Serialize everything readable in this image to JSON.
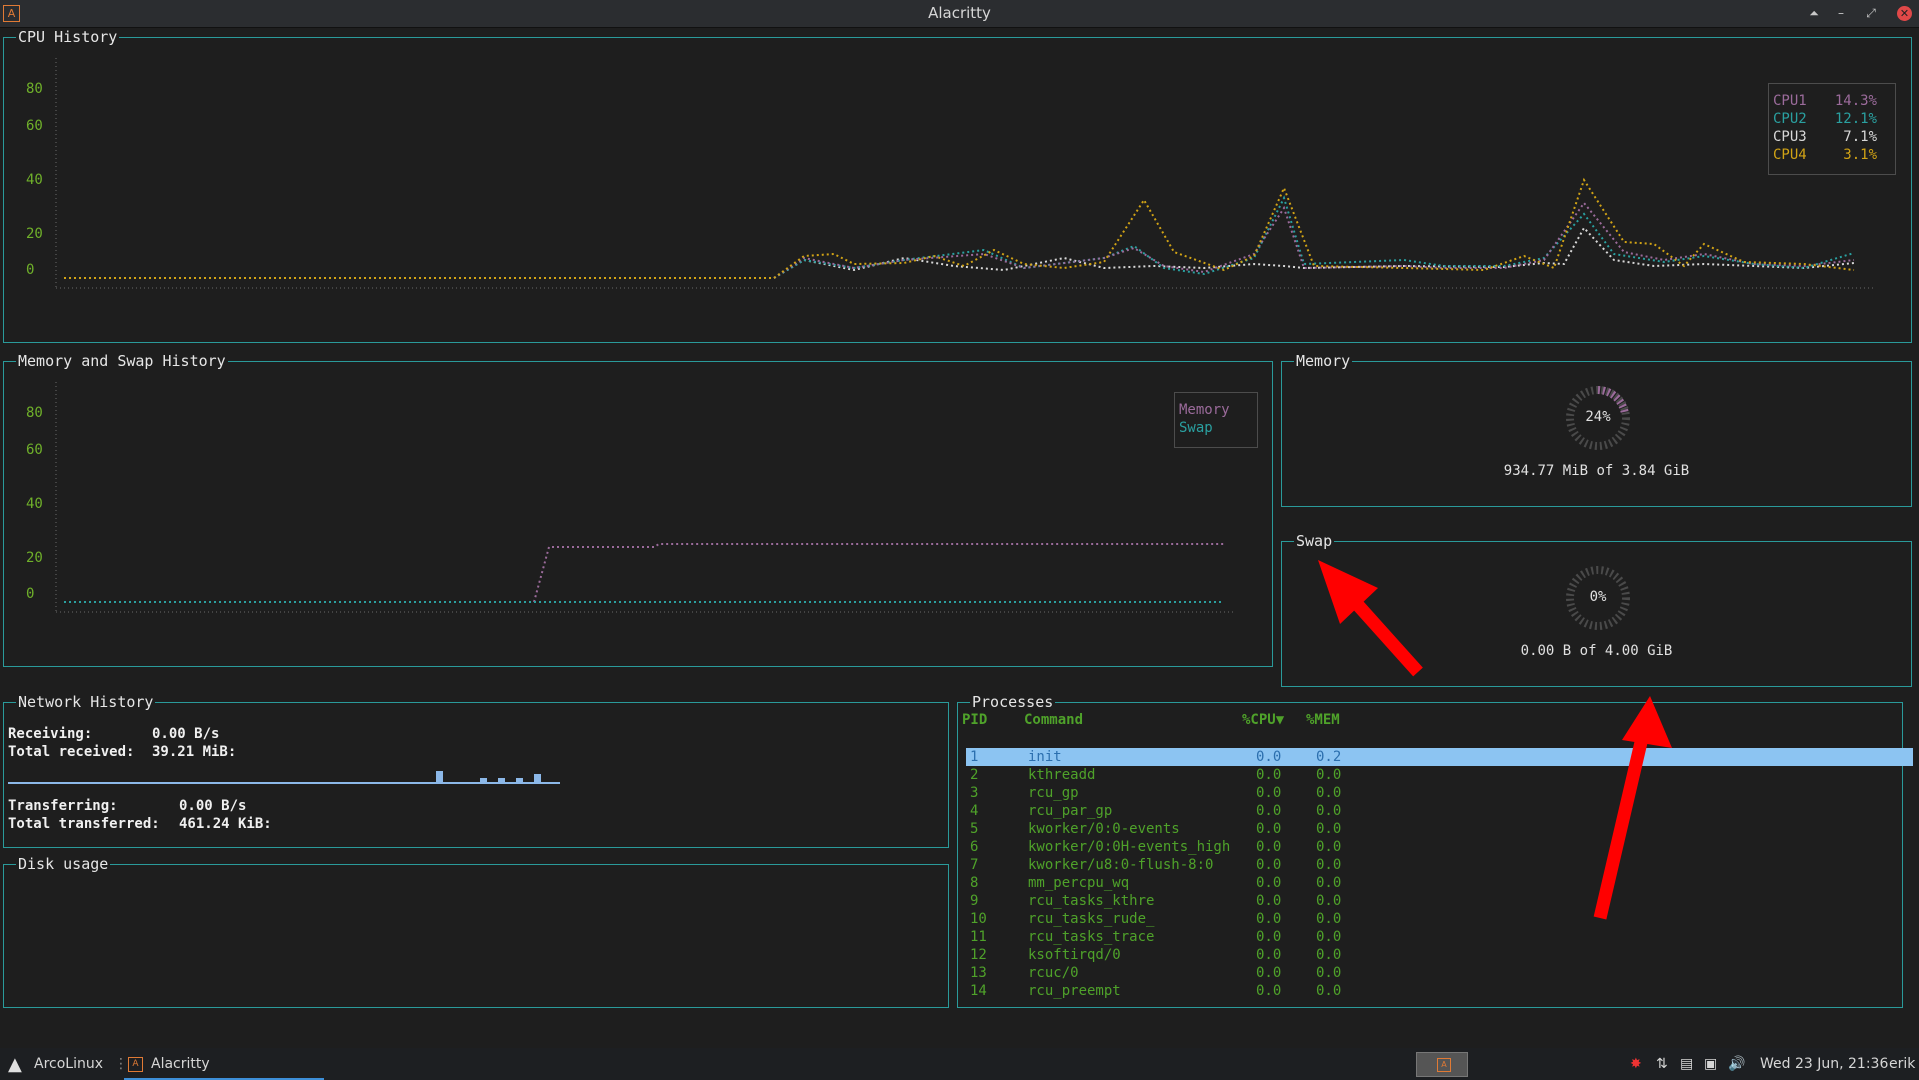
{
  "window": {
    "title": "Alacritty",
    "app_icon": "A"
  },
  "cpu_history": {
    "title": "CPU History",
    "y_ticks": [
      "80",
      "60",
      "40",
      "20",
      "0"
    ],
    "legend": [
      {
        "name": "CPU1",
        "value": "14.3%",
        "color": "#9b6b9b"
      },
      {
        "name": "CPU2",
        "value": "12.1%",
        "color": "#2aa0a0"
      },
      {
        "name": "CPU3",
        "value": "7.1%",
        "color": "#d8d8d8"
      },
      {
        "name": "CPU4",
        "value": "3.1%",
        "color": "#d1a315"
      }
    ]
  },
  "mem_history": {
    "title": "Memory and Swap History",
    "y_ticks": [
      "80",
      "60",
      "40",
      "20",
      "0"
    ],
    "legend": [
      {
        "name": "Memory",
        "color": "#9b6b9b"
      },
      {
        "name": "Swap",
        "color": "#2aa0a0"
      }
    ]
  },
  "memory": {
    "title": "Memory",
    "percent": "24%",
    "detail": "934.77 MiB of 3.84 GiB"
  },
  "swap": {
    "title": "Swap",
    "percent": "0%",
    "detail": "0.00 B of 4.00 GiB"
  },
  "network": {
    "title": "Network History",
    "receiving_label": "Receiving:",
    "receiving_value": "0.00 B/s",
    "total_received_label": "Total received:",
    "total_received_value": "39.21 MiB:",
    "transferring_label": "Transferring:",
    "transferring_value": "0.00 B/s",
    "total_transferred_label": "Total transferred:",
    "total_transferred_value": "461.24 KiB:"
  },
  "disk": {
    "title": "Disk usage"
  },
  "processes": {
    "title": "Processes",
    "headers": {
      "pid": "PID",
      "command": "Command",
      "cpu": "%CPU▼",
      "mem": "%MEM"
    },
    "rows": [
      {
        "pid": "1",
        "command": "init",
        "cpu": "0.0",
        "mem": "0.2"
      },
      {
        "pid": "2",
        "command": "kthreadd",
        "cpu": "0.0",
        "mem": "0.0"
      },
      {
        "pid": "3",
        "command": "rcu_gp",
        "cpu": "0.0",
        "mem": "0.0"
      },
      {
        "pid": "4",
        "command": "rcu_par_gp",
        "cpu": "0.0",
        "mem": "0.0"
      },
      {
        "pid": "5",
        "command": "kworker/0:0-events",
        "cpu": "0.0",
        "mem": "0.0"
      },
      {
        "pid": "6",
        "command": "kworker/0:0H-events_high",
        "cpu": "0.0",
        "mem": "0.0"
      },
      {
        "pid": "7",
        "command": "kworker/u8:0-flush-8:0",
        "cpu": "0.0",
        "mem": "0.0"
      },
      {
        "pid": "8",
        "command": "mm_percpu_wq",
        "cpu": "0.0",
        "mem": "0.0"
      },
      {
        "pid": "9",
        "command": "rcu_tasks_kthre",
        "cpu": "0.0",
        "mem": "0.0"
      },
      {
        "pid": "10",
        "command": "rcu_tasks_rude_",
        "cpu": "0.0",
        "mem": "0.0"
      },
      {
        "pid": "11",
        "command": "rcu_tasks_trace",
        "cpu": "0.0",
        "mem": "0.0"
      },
      {
        "pid": "12",
        "command": "ksoftirqd/0",
        "cpu": "0.0",
        "mem": "0.0"
      },
      {
        "pid": "13",
        "command": "rcuc/0",
        "cpu": "0.0",
        "mem": "0.0"
      },
      {
        "pid": "14",
        "command": "rcu_preempt",
        "cpu": "0.0",
        "mem": "0.0"
      }
    ]
  },
  "taskbar": {
    "start_label": "ArcoLinux",
    "task_label": "Alacritty",
    "clock": "Wed 23 Jun, 21:36",
    "user": "erik"
  },
  "colors": {
    "border": "#2a9a9a",
    "axis": "#6fb02a",
    "arrow": "#ff0000",
    "selected_row": "#8cc4f2"
  }
}
